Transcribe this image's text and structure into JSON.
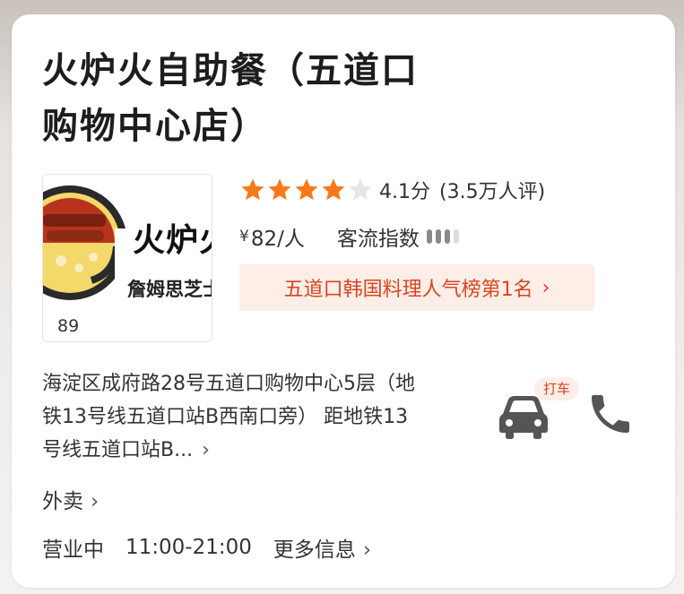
{
  "shop": {
    "name": "火炉火自助餐（五道口购物中心店）",
    "thumbnail": {
      "logo_text": "火炉火",
      "logo_subtext": "詹姆思芝士",
      "photo_count": "89"
    },
    "rating": {
      "stars": 4.1,
      "score_text": "4.1分",
      "count_text": "(3.5万人评)",
      "star_color": "#f7791a"
    },
    "price": {
      "currency": "¥",
      "amount": "82/人"
    },
    "traffic": {
      "label": "客流指数",
      "level": 3,
      "max_level": 4
    },
    "rank_badge": {
      "text": "五道口韩国料理人气榜第1名",
      "chevron": "›"
    },
    "address": {
      "text": "海淀区成府路28号五道口购物中心5层（地铁13号线五道口站B西南口旁） 距地铁13号线五道口站B...",
      "chevron": "›"
    },
    "actions": {
      "taxi_badge": "打车",
      "taxi_icon": "car-icon",
      "phone_icon": "phone-icon"
    },
    "takeout": {
      "label": "外卖",
      "chevron": "›"
    },
    "hours": {
      "status": "营业中",
      "time": "11:00-21:00",
      "more_label": "更多信息",
      "chevron": "›"
    }
  },
  "colors": {
    "accent_orange": "#d8451f",
    "badge_bg": "#fdeee8",
    "icon_gray": "#555555"
  }
}
